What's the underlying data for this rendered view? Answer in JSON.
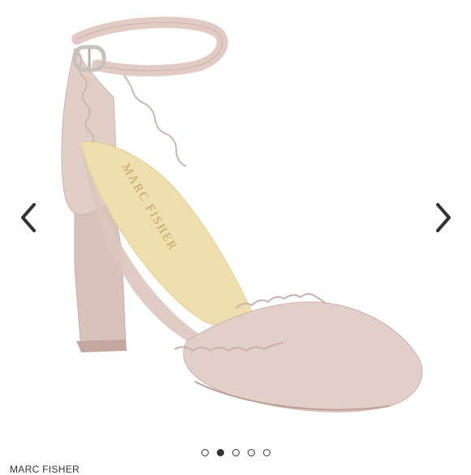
{
  "product": {
    "insole_brand": "MARC FISHER",
    "image_alt": "Blush suede scalloped ankle-strap block heel pump",
    "colors": {
      "suede": "#e3cfc9",
      "suede_shadow": "#c9b0a8",
      "insole": "#f0dfae",
      "buckle": "#c7c2bd"
    }
  },
  "carousel": {
    "prev_icon": "chevron-left-icon",
    "next_icon": "chevron-right-icon",
    "dots": [
      {
        "state": "inactive"
      },
      {
        "state": "active"
      },
      {
        "state": "inactive"
      },
      {
        "state": "inactive"
      },
      {
        "state": "inactive"
      }
    ]
  },
  "caption": {
    "brand": "MARC FISHER"
  }
}
